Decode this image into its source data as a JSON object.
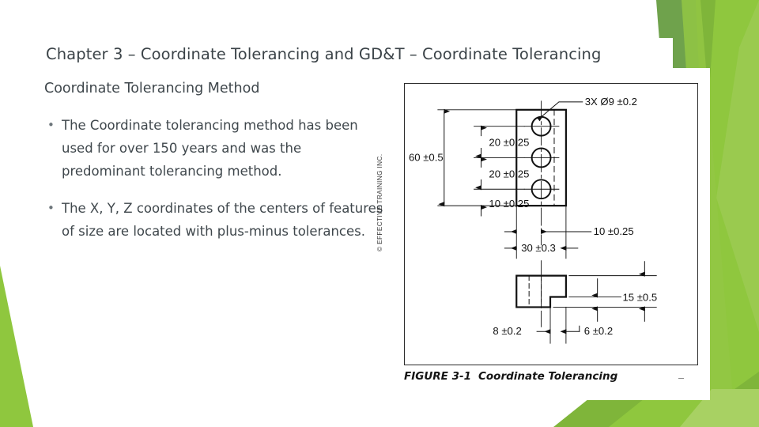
{
  "slide": {
    "title": "Chapter 3 – Coordinate Tolerancing and GD&T – Coordinate Tolerancing",
    "subheading": "Coordinate Tolerancing Method",
    "bullet_marker": "•",
    "bullets": [
      "The Coordinate tolerancing method has been used for over 150 years and was the predominant tolerancing method.",
      "The X, Y, Z coordinates of the centers of features of size are located with plus-minus tolerances."
    ]
  },
  "figure": {
    "caption_label": "FIGURE 3-1",
    "caption_title": "Coordinate Tolerancing",
    "copyright": "© EFFECTIVE TRAINING INC.",
    "callouts": {
      "hole_callout": "3X Ø9 ±0.2",
      "overall_height": "60 ±0.5",
      "pitch_upper": "20 ±0.25",
      "pitch_lower": "20 ±0.25",
      "edge_to_hole": "10 ±0.25",
      "horiz_edge": "10 ±0.25",
      "horiz_width": "30 ±0.3",
      "side_height": "15 ±0.5",
      "side_step_left": "8 ±0.2",
      "side_step_right": "6 ±0.2"
    }
  },
  "colors": {
    "green_bright": "#8FC73E",
    "green_mid": "#7FB53A",
    "green_dark": "#6FA24C",
    "green_light": "#9ECB55",
    "green_pale": "#A8D163",
    "text_dark": "#3f474c",
    "line_black": "#1a1a1a"
  }
}
